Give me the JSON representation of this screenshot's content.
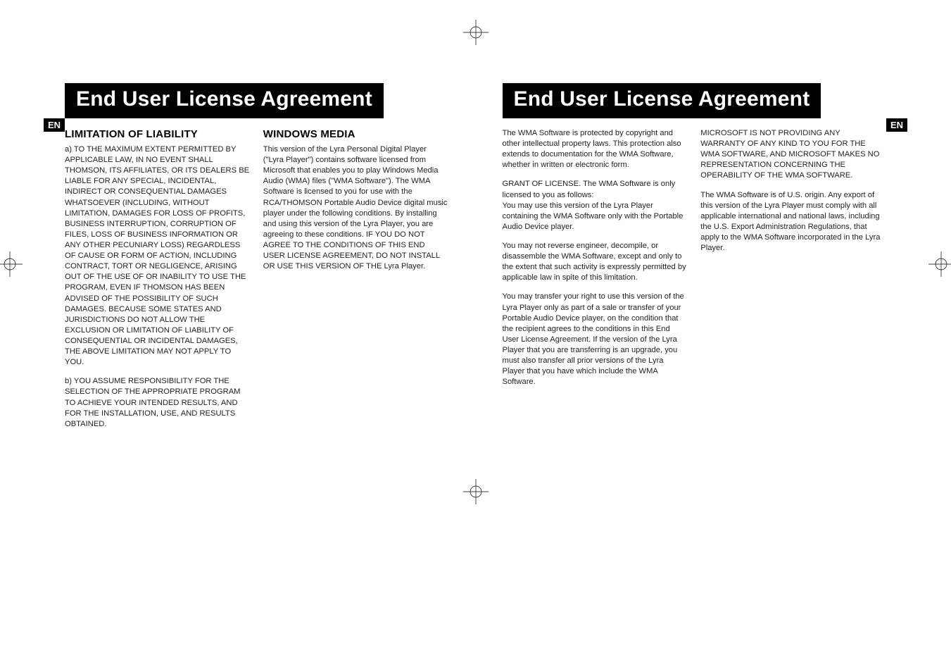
{
  "lang_badge": "EN",
  "left": {
    "title": "End User License Agreement",
    "col1": {
      "heading": "LIMITATION OF LIABILITY",
      "para_a": "a) TO THE MAXIMUM EXTENT PERMITTED BY APPLICABLE LAW, IN NO EVENT SHALL THOMSON, ITS AFFILIATES, OR ITS DEALERS BE LIABLE FOR ANY SPECIAL, INCIDENTAL, INDIRECT OR CONSEQUENTIAL DAMAGES WHATSOEVER (INCLUDING, WITHOUT LIMITATION, DAMAGES FOR LOSS OF PROFITS, BUSINESS INTERRUPTION, CORRUPTION OF FILES, LOSS OF BUSINESS INFORMATION OR ANY OTHER PECUNIARY LOSS) REGARDLESS OF CAUSE OR FORM OF ACTION, INCLUDING CONTRACT, TORT OR NEGLIGENCE, ARISING OUT OF THE USE OF OR INABILITY TO USE THE PROGRAM, EVEN IF THOMSON HAS BEEN ADVISED OF THE POSSIBILITY OF SUCH DAMAGES. BECAUSE SOME STATES AND JURISDICTIONS DO NOT ALLOW THE EXCLUSION OR LIMITATION OF LIABILITY OF CONSEQUENTIAL OR INCIDENTAL DAMAGES, THE ABOVE LIMITATION MAY NOT APPLY TO YOU.",
      "para_b": "b) YOU ASSUME RESPONSIBILITY FOR THE SELECTION OF THE APPROPRIATE PROGRAM TO ACHIEVE YOUR INTENDED RESULTS, AND FOR THE INSTALLATION, USE, AND RESULTS OBTAINED."
    },
    "col2": {
      "heading": "WINDOWS MEDIA",
      "para": "This version of the Lyra Personal Digital Player (\"Lyra Player\") contains software licensed from Microsoft that enables you to play Windows Media Audio (WMA) files (\"WMA Software\"). The WMA Software is licensed to you for use with the RCA/THOMSON Portable Audio Device digital music player under the following conditions.  By installing and using this version of the Lyra Player, you are agreeing to these conditions.  IF YOU DO NOT AGREE TO THE CONDITIONS OF THIS END USER LICENSE AGREEMENT, DO NOT INSTALL OR USE THIS VERSION OF THE Lyra Player."
    }
  },
  "right": {
    "title": "End User License Agreement",
    "col1": {
      "para1": "The WMA Software is protected by copyright and other intellectual property laws.  This protection also extends to documentation for the WMA Software, whether in written or electronic form.",
      "para2": "GRANT OF LICENSE. The WMA Software is only licensed to you as follows:\nYou may use this version of the Lyra Player containing the WMA Software only with the Portable Audio Device player.",
      "para3": "You may not reverse engineer, decompile, or disassemble the WMA Software, except and only to the extent that such activity is expressly permitted by applicable law in spite of this limitation.",
      "para4": "You may transfer your right to use this version of the Lyra Player only as part of a sale or transfer of your Portable Audio Device player, on the condition that the recipient agrees to the conditions in this End User License Agreement.  If the version of the Lyra Player that you are transferring is an upgrade, you must also transfer all prior versions of the Lyra Player that you have which include the WMA Software."
    },
    "col2": {
      "para1": "MICROSOFT IS NOT PROVIDING ANY WARRANTY OF ANY KIND TO YOU FOR THE WMA SOFTWARE, AND MICROSOFT MAKES NO REPRESENTATION CONCERNING THE OPERABILITY OF THE WMA SOFTWARE.",
      "para2": "The WMA Software is of U.S. origin.  Any export of this version of the Lyra Player must comply with all applicable international and national laws, including the U.S. Export Administration Regulations, that apply to the WMA Software incorporated in the Lyra Player."
    }
  }
}
